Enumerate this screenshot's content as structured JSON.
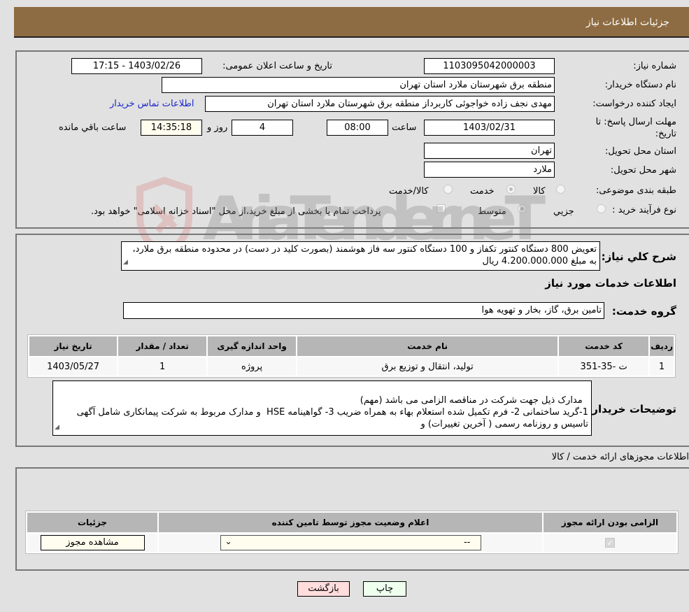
{
  "header": {
    "title": "جزئیات اطلاعات نیاز"
  },
  "details": {
    "need_number_label": "شماره نیاز:",
    "need_number": "1103095042000003",
    "announce_label": "تاریخ و ساعت اعلان عمومی:",
    "announce_value": "1403/02/26 - 17:15",
    "buyer_org_label": "نام دستگاه خریدار:",
    "buyer_org": "منطقه برق شهرستان ملارد استان تهران",
    "creator_label": "ایجاد کننده درخواست:",
    "creator": "مهدی نجف زاده خواجوئی کاربرداز منطقه برق شهرستان ملارد استان تهران",
    "contact_link": "اطلاعات تماس خریدار",
    "deadline_label": "مهلت ارسال پاسخ: تا تاریخ:",
    "deadline_date": "1403/02/31",
    "time_label": "ساعت",
    "deadline_time": "08:00",
    "days_value": "4",
    "days_label": "روز و",
    "remaining_time": "14:35:18",
    "remaining_label": "ساعت باقي مانده",
    "province_label": "استان محل تحویل:",
    "province": "تهران",
    "city_label": "شهر محل تحویل:",
    "city": "ملارد",
    "category_label": "طبقه بندی موضوعی:",
    "category_options": [
      "کالا",
      "خدمت",
      "کالا/خدمت"
    ],
    "category_selected": "خدمت",
    "process_label": "نوع فرآیند خرید :",
    "process_options": [
      "جزيي",
      "متوسط"
    ],
    "process_selected": "متوسط",
    "treasury_note": "پرداخت تمام یا بخشی از مبلغ خرید،از محل \"اسناد خزانه اسلامی\" خواهد بود."
  },
  "description": {
    "label": "شرح کلي نیاز:",
    "text": "تعویض 800 دستگاه کنتور تکفاز و 100 دستگاه کنتور سه فاز هوشمند (بصورت کلید در دست)  در محدوده منطقه برق ملارد، به مبلغ 4.200.000.000 ریال",
    "services_heading": "اطلاعات خدمات مورد نیاز",
    "service_group_label": "گروه خدمت:",
    "service_group": "تامین برق، گاز، بخار و تهویه هوا"
  },
  "services_table": {
    "headers": [
      "ردیف",
      "کد خدمت",
      "نام خدمت",
      "واحد اندازه گیری",
      "تعداد / مقدار",
      "تاریخ نیاز"
    ],
    "rows": [
      [
        "1",
        "ت -35-351",
        "تولید، انتقال و توزیع برق",
        "پروژه",
        "1",
        "1403/05/27"
      ]
    ]
  },
  "buyer_notes": {
    "label": "توضیحات خریدار:",
    "text": "مدارک ذیل جهت شرکت در مناقصه الزامی می باشد (مهم)\n1-گرید ساختمانی 2- فرم تکمیل شده استعلام بهاء به همراه ضریب 3- گواهینامه HSE  و مدارک مربوط به شرکت پیمانکاری شامل آگهی تاسیس و روزنامه رسمی ( آخرین تغییرات) و"
  },
  "permits": {
    "heading": "اطلاعات مجوزهای ارائه خدمت / کالا",
    "headers": [
      "الزامی بودن ارائه مجوز",
      "اعلام وضعیت مجوز توسط تامین کننده",
      "جزئیات"
    ],
    "row": {
      "required_checked": true,
      "status_value": "--",
      "details_button": "مشاهده مجوز"
    }
  },
  "footer": {
    "print_button": "چاپ",
    "back_button": "بازگشت"
  },
  "watermark": "AriaTender.neT"
}
